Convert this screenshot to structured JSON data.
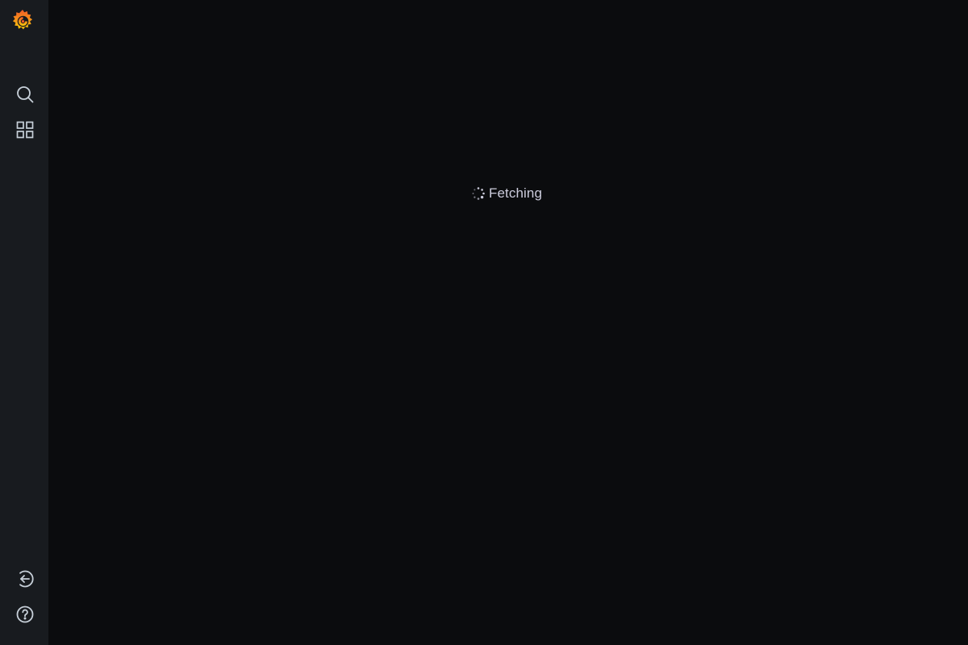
{
  "app": {
    "brand_colors": {
      "primary": "#f05a28",
      "secondary": "#fbca0a"
    },
    "logo_icon": "grafana-logo-icon"
  },
  "sidemenu": {
    "top_items": [
      {
        "icon": "search-icon"
      },
      {
        "icon": "dashboards-grid-icon"
      }
    ],
    "bottom_items": [
      {
        "icon": "sign-in-arrow-icon"
      },
      {
        "icon": "help-icon"
      }
    ]
  },
  "main": {
    "loading": {
      "icon": "spinner-icon",
      "text": "Fetching"
    }
  },
  "colors": {
    "background": "#0b0c0e",
    "sidebar": "#181b1f",
    "icon": "#c7d0d9",
    "text": "#ccccdc"
  }
}
